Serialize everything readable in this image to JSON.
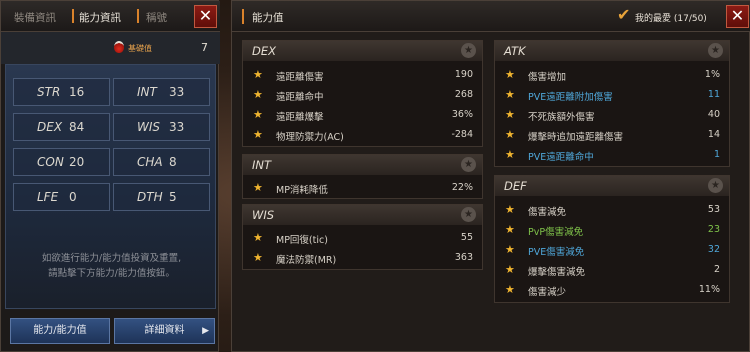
{
  "left_panel": {
    "tabs": [
      "裝備資訊",
      "能力資訊",
      "稱號"
    ],
    "close_label": "✕",
    "bonus": {
      "label": "基礎值",
      "value": "7"
    },
    "stats": [
      {
        "name": "STR",
        "value": "16"
      },
      {
        "name": "INT",
        "value": "33"
      },
      {
        "name": "DEX",
        "value": "84"
      },
      {
        "name": "WIS",
        "value": "33"
      },
      {
        "name": "CON",
        "value": "20"
      },
      {
        "name": "CHA",
        "value": "8"
      },
      {
        "name": "LFE",
        "value": "0"
      },
      {
        "name": "DTH",
        "value": "5"
      }
    ],
    "note_line1": "如欲進行能力/能力值投資及重置,",
    "note_line2": "請點擊下方能力/能力值按鈕。",
    "btn_ability": "能力/能力值",
    "btn_detail": "詳細資料",
    "btn_arrow": "▶"
  },
  "right_panel": {
    "title": "能力值",
    "favorites_label": "我的最愛 (17/50)",
    "close_label": "✕",
    "sections": {
      "dex": {
        "title": "DEX",
        "rows": [
          {
            "label": "遠距離傷害",
            "value": "190"
          },
          {
            "label": "遠距離命中",
            "value": "268"
          },
          {
            "label": "遠距離爆擊",
            "value": "36%"
          },
          {
            "label": "物理防禦力(AC)",
            "value": "-284"
          }
        ]
      },
      "int": {
        "title": "INT",
        "rows": [
          {
            "label": "MP消耗降低",
            "value": "22%"
          }
        ]
      },
      "wis": {
        "title": "WIS",
        "rows": [
          {
            "label": "MP回復(tic)",
            "value": "55"
          },
          {
            "label": "魔法防禦(MR)",
            "value": "363"
          }
        ]
      },
      "atk": {
        "title": "ATK",
        "rows": [
          {
            "label": "傷害增加",
            "value": "1%"
          },
          {
            "label": "PVE遠距離附加傷害",
            "value": "11"
          },
          {
            "label": "不死族額外傷害",
            "value": "40"
          },
          {
            "label": "爆擊時追加遠距離傷害",
            "value": "14"
          },
          {
            "label": "PVE遠距離命中",
            "value": "1"
          }
        ]
      },
      "def": {
        "title": "DEF",
        "rows": [
          {
            "label": "傷害減免",
            "value": "53"
          },
          {
            "label": "PvP傷害減免",
            "value": "23"
          },
          {
            "label": "PVE傷害減免",
            "value": "32"
          },
          {
            "label": "爆擊傷害減免",
            "value": "2"
          },
          {
            "label": "傷害減少",
            "value": "11%"
          }
        ]
      }
    }
  },
  "icons": {
    "star": "star-icon",
    "check": "checkmark-icon",
    "potion": "potion-icon"
  },
  "colors": {
    "accent": "#d9822b",
    "star": "#f0b530",
    "pve_blue": "#4fa6d8",
    "pvp_green": "#7fc24a",
    "close_red": "#8c1b14"
  }
}
